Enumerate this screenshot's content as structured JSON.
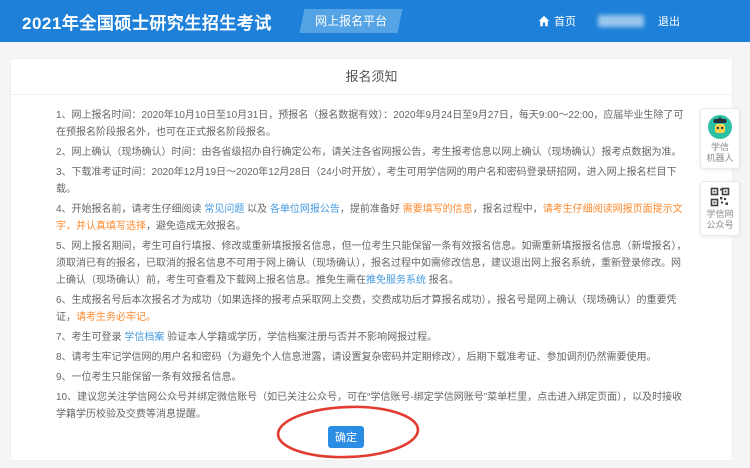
{
  "header": {
    "title": "2021年全国硕士研究生招生考试",
    "badge": "网上报名平台",
    "home_label": "首页",
    "logout_label": "退出"
  },
  "notice": {
    "title": "报名须知",
    "confirm_label": "确定",
    "items": [
      {
        "segments": [
          {
            "text": "1、网上报名时间：2020年10月10日至10月31日，预报名（报名数据有效）：2020年9月24日至9月27日，每天9:00～22:00，应届毕业生除了可在预报名阶段报名外，也可在正式报名阶段报名。",
            "style": "normal"
          }
        ]
      },
      {
        "segments": [
          {
            "text": "2、网上确认（现场确认）时间：由各省级招办自行确定公布，请关注各省网报公告，考生报考信息以网上确认（现场确认）报考点数据为准。",
            "style": "normal"
          }
        ]
      },
      {
        "segments": [
          {
            "text": "3、下载准考证时间：2020年12月19日～2020年12月28日（24小时开放），考生可用学信网的用户名和密码登录研招网，进入网上报名栏目下载。",
            "style": "normal"
          }
        ]
      },
      {
        "segments": [
          {
            "text": "4、开始报名前，请考生仔细阅读 ",
            "style": "normal"
          },
          {
            "text": "常见问题",
            "style": "link"
          },
          {
            "text": " 以及 ",
            "style": "normal"
          },
          {
            "text": "各单位网报公告",
            "style": "link"
          },
          {
            "text": "，提前准备好 ",
            "style": "normal"
          },
          {
            "text": "需要填写的信息",
            "style": "orange-link"
          },
          {
            "text": "，报名过程中，",
            "style": "normal"
          },
          {
            "text": "请考生仔细阅读网报页面提示文字，并认真填写选择",
            "style": "orange"
          },
          {
            "text": "，避免造成无效报名。",
            "style": "normal"
          }
        ]
      },
      {
        "segments": [
          {
            "text": "5、网上报名期间，考生可自行填报、修改或重新填报报名信息，但一位考生只能保留一条有效报名信息。如需重新填报报名信息（新增报名），须取消已有的报名，已取消的报名信息不可用于网上确认（现场确认），报名过程中如需修改信息，建议退出网上报名系统，重新登录修改。网上确认（现场确认）前，考生可查看及下载网上报名信息。推免生需在",
            "style": "normal"
          },
          {
            "text": "推免服务系统",
            "style": "link"
          },
          {
            "text": " 报名。",
            "style": "normal"
          }
        ]
      },
      {
        "segments": [
          {
            "text": "6、生成报名号后本次报名才为成功（如果选择的报考点采取网上交费，交费成功后才算报名成功），报名号是网上确认（现场确认）的重要凭证，",
            "style": "normal"
          },
          {
            "text": "请考生务必牢记。",
            "style": "orange"
          }
        ]
      },
      {
        "segments": [
          {
            "text": "7、考生可登录 ",
            "style": "normal"
          },
          {
            "text": "学信档案",
            "style": "link"
          },
          {
            "text": " 验证本人学籍或学历，学信档案注册与否并不影响网报过程。",
            "style": "normal"
          }
        ]
      },
      {
        "segments": [
          {
            "text": "8、请考生牢记学信网的用户名和密码（为避免个人信息泄露，请设置复杂密码并定期修改），后期下载准考证、参加调剂仍然需要使用。",
            "style": "normal"
          }
        ]
      },
      {
        "segments": [
          {
            "text": "9、一位考生只能保留一条有效报名信息。",
            "style": "normal"
          }
        ]
      },
      {
        "segments": [
          {
            "text": "10、建议您关注学信网公众号并绑定微信账号（如已关注公众号，可在“学信账号-绑定学信网账号”菜单栏里，点击进入绑定页面），以及时接收学籍学历校验及交费等消息提醒。",
            "style": "normal"
          }
        ]
      }
    ]
  },
  "sidebar": {
    "robot_lines": [
      "学信",
      "机器人"
    ],
    "qr_lines": [
      "学信网",
      "公众号"
    ]
  },
  "colors": {
    "header_blue": "#1e80d8",
    "badge_blue": "#54a3e5",
    "link_blue": "#459ae0",
    "highlight_orange": "#ff8a2e",
    "button_blue": "#2b8ce4",
    "annotation_red": "#e23b30"
  }
}
